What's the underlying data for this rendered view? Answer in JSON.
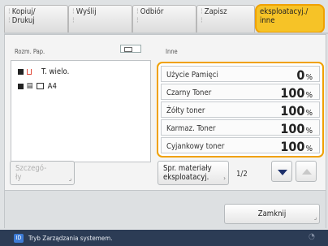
{
  "tabs": [
    {
      "line1": "Kopiuj/",
      "line2": "Drukuj",
      "active": false
    },
    {
      "line1": "Wyślij",
      "line2": "",
      "active": false
    },
    {
      "line1": "Odbiór",
      "line2": "",
      "active": false
    },
    {
      "line1": "Zapisz",
      "line2": "",
      "active": false
    },
    {
      "line1": "eksploatacyj./",
      "line2": "inne",
      "active": true
    }
  ],
  "paper": {
    "header": "Rozm. Pap.",
    "rows": [
      {
        "label": "T. wielo."
      },
      {
        "label": "A4"
      }
    ]
  },
  "consumables": {
    "header": "Inne",
    "rows": [
      {
        "name": "Użycie Pamięci",
        "value": "0",
        "unit": "%"
      },
      {
        "name": "Czarny Toner",
        "value": "100",
        "unit": "%"
      },
      {
        "name": "Żółty toner",
        "value": "100",
        "unit": "%"
      },
      {
        "name": "Karmaz. Toner",
        "value": "100",
        "unit": "%"
      },
      {
        "name": "Cyjankowy toner",
        "value": "100",
        "unit": "%"
      }
    ]
  },
  "buttons": {
    "details_line1": "Szczegó-",
    "details_line2": "ły",
    "supplies_line1": "Spr. materiały",
    "supplies_line2": "eksploatacyj.",
    "close": "Zamknij"
  },
  "pagination": {
    "label": "1/2"
  },
  "status": {
    "text": "Tryb Zarządzania systemem."
  },
  "colors": {
    "accent": "#f6c327",
    "accent_border": "#f0a100",
    "status_bar": "#2c3c55"
  }
}
